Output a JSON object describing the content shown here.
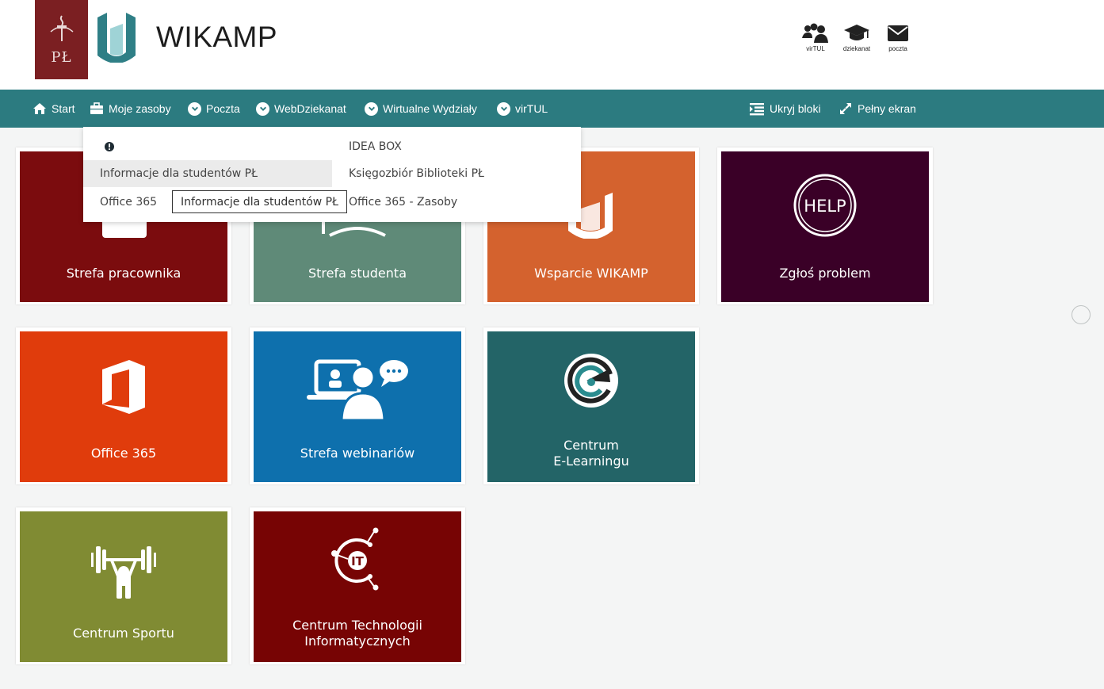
{
  "header": {
    "title": "WIKAMP",
    "logo_left_text": "PŁ",
    "top_links": [
      {
        "label": "virTUL",
        "icon": "users-icon"
      },
      {
        "label": "dziekanat",
        "icon": "graduation-cap-icon"
      },
      {
        "label": "poczta",
        "icon": "envelope-icon"
      }
    ]
  },
  "nav": {
    "items": [
      {
        "label": "Start",
        "icon": "home-icon"
      },
      {
        "label": "Moje zasoby",
        "icon": "briefcase-icon"
      },
      {
        "label": "Poczta",
        "icon": "chevron-down-icon"
      },
      {
        "label": "WebDziekanat",
        "icon": "chevron-down-icon"
      },
      {
        "label": "Wirtualne Wydziały",
        "icon": "chevron-down-icon"
      },
      {
        "label": "virTUL",
        "icon": "chevron-down-icon"
      }
    ],
    "right_items": [
      {
        "label": "Ukryj bloki",
        "icon": "list-icon"
      },
      {
        "label": "Pełny ekran",
        "icon": "expand-icon"
      }
    ]
  },
  "dropdown": {
    "left_column": [
      "",
      "Informacje dla studentów PŁ",
      "Office 365"
    ],
    "right_column": [
      "IDEA BOX",
      "Księgozbiór Biblioteki PŁ",
      "Office 365 - Zasoby"
    ],
    "tooltip": "Informacje dla studentów PŁ"
  },
  "colors": {
    "navbar": "#2c7b80",
    "pracownika": "#7b0c0e",
    "studenta": "#5f8a78",
    "wsparcie": "#d4622e",
    "zglos": "#3a0027",
    "office": "#e03c0c",
    "webinaria": "#0e70ad",
    "elearning": "#236467",
    "sport": "#808b33",
    "cti": "#770404"
  },
  "tiles": [
    {
      "label": "Strefa pracownika",
      "icon": "employee-icon"
    },
    {
      "label": "Strefa studenta",
      "icon": "student-icon"
    },
    {
      "label": "Wsparcie WIKAMP",
      "icon": "wikamp-logo-icon"
    },
    {
      "label": "Zgłoś problem",
      "icon": "help-icon",
      "icon_text": "HELP"
    },
    {
      "label": "Office 365",
      "icon": "office-icon"
    },
    {
      "label": "Strefa webinariów",
      "icon": "webinar-icon"
    },
    {
      "label_line1": "Centrum",
      "label_line2": "E-Learningu",
      "icon": "elearning-icon"
    },
    {
      "label": "Centrum Sportu",
      "icon": "weightlifter-icon"
    },
    {
      "label_line1": "Centrum Technologii",
      "label_line2": "Informatycznych",
      "icon": "cti-icon",
      "icon_text": "IT"
    }
  ]
}
